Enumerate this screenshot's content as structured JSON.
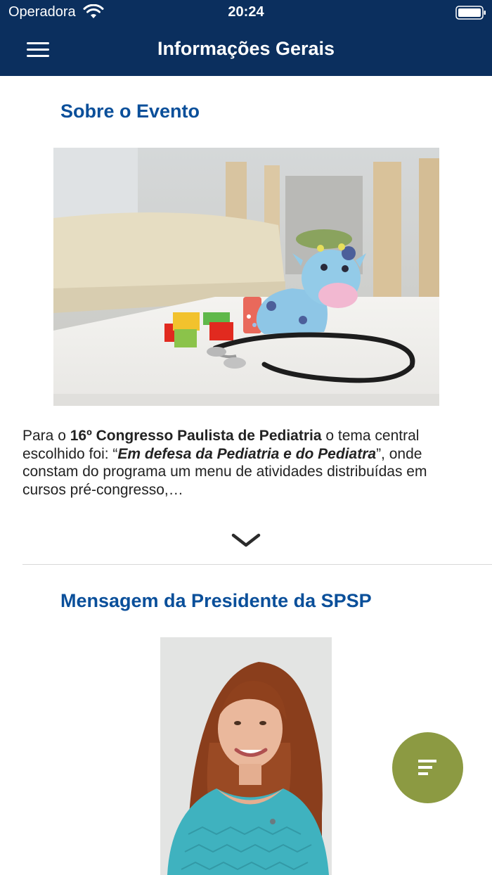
{
  "status_bar": {
    "carrier": "Operadora",
    "time": "20:24"
  },
  "nav": {
    "title": "Informações Gerais",
    "menu_icon": "hamburger-menu-icon"
  },
  "sections": [
    {
      "title": "Sobre o Evento",
      "image": "pediatric-toys-stethoscope-photo",
      "summary": {
        "p1": "Para o ",
        "b1": "16º Congresso Paulista de Pediatria",
        "p2": " o tema central escolhido foi: “",
        "bi1": "Em defesa da Pediatria e do Pediatra",
        "p3": "”, onde constam do programa um menu de atividades distribuídas em cursos pré-congresso,…"
      },
      "expand_icon": "chevron-down-icon"
    },
    {
      "title": "Mensagem da Presidente da SPSP",
      "image": "president-portrait-photo"
    }
  ],
  "fab": {
    "icon": "text-lines-icon",
    "color": "#8c9a42"
  },
  "colors": {
    "header": "#0b2f5e",
    "section_title": "#0a4f9a"
  }
}
